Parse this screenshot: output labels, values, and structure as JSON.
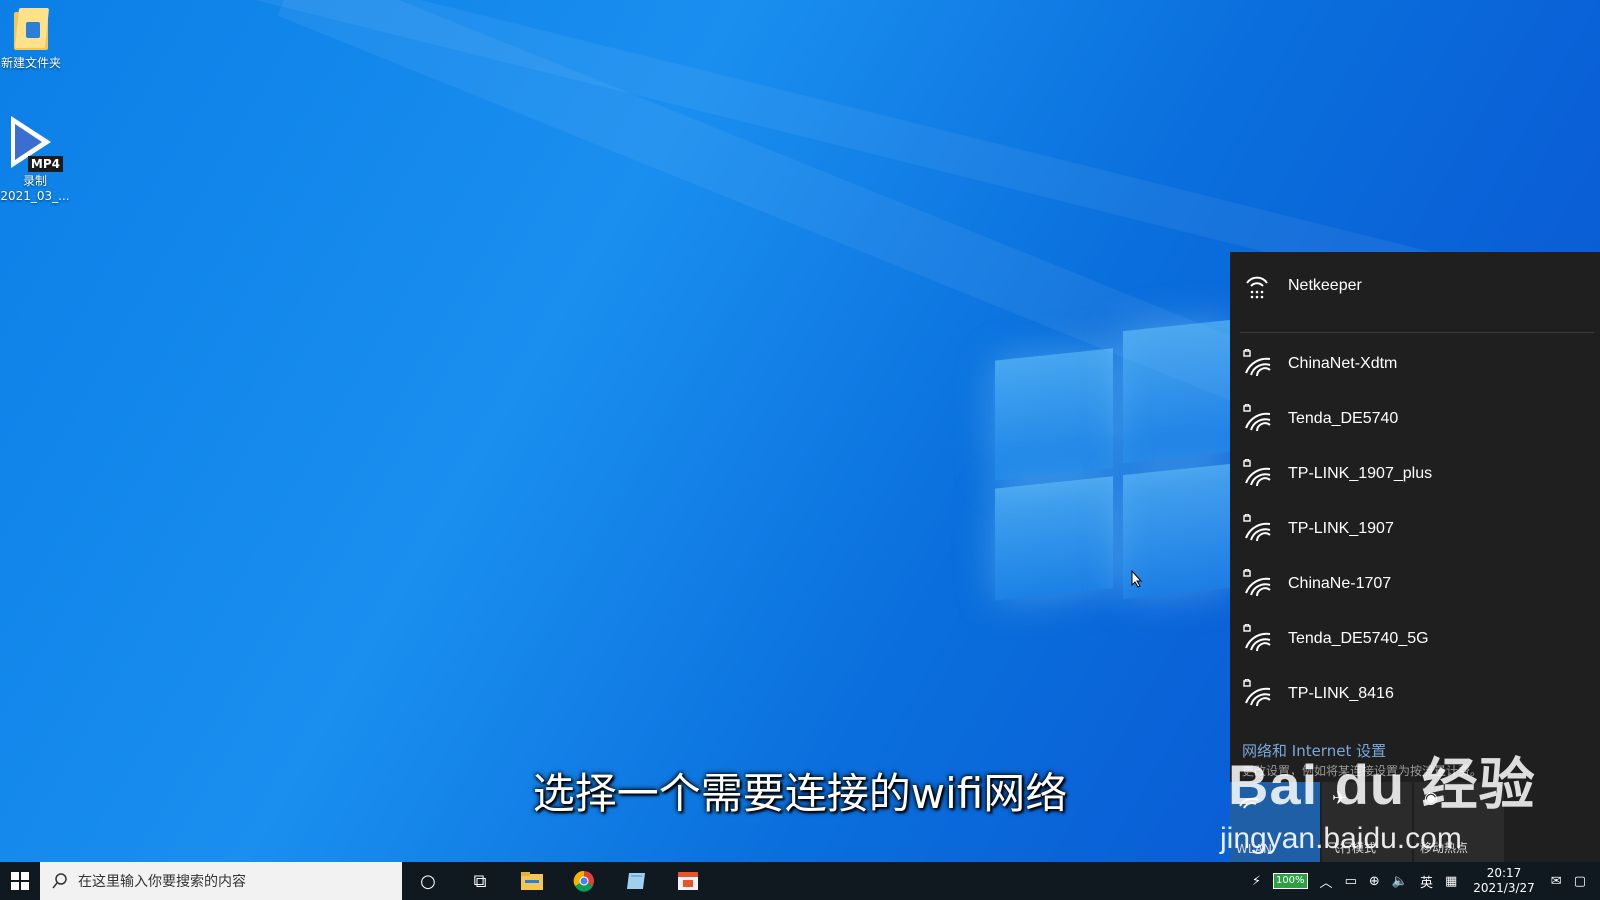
{
  "desktop": {
    "icons": [
      {
        "label": "新建文件夹"
      },
      {
        "label_line1": "录制",
        "label_line2": "2021_03_...",
        "badge": "MP4"
      }
    ]
  },
  "wifi_panel": {
    "connected": {
      "name": "Netkeeper",
      "icon": "dialup-icon"
    },
    "networks": [
      {
        "name": "ChinaNet-Xdtm",
        "secured": true
      },
      {
        "name": "Tenda_DE5740",
        "secured": true
      },
      {
        "name": "TP-LINK_1907_plus",
        "secured": true
      },
      {
        "name": "TP-LINK_1907",
        "secured": true
      },
      {
        "name": "ChinaNe-1707",
        "secured": true
      },
      {
        "name": "Tenda_DE5740_5G",
        "secured": true
      },
      {
        "name": "TP-LINK_8416",
        "secured": true
      }
    ],
    "settings_title": "网络和 Internet 设置",
    "settings_desc": "更改设置，例如将某连接设置为按流量计费。",
    "quick_actions": [
      {
        "label": "WLAN",
        "active": true
      },
      {
        "label": "飞行模式",
        "active": false
      },
      {
        "label": "移动热点",
        "active": false
      }
    ]
  },
  "watermark": {
    "brand": "Bai du 经验",
    "url": "jingyan.baidu.com"
  },
  "subtitle": "选择一个需要连接的wifi网络",
  "taskbar": {
    "search_placeholder": "在这里输入你要搜索的内容",
    "tray": {
      "battery": "100%",
      "ime_lang": "英",
      "time": "20:17",
      "date": "2021/3/27"
    }
  },
  "colors": {
    "accent": "#1f5fa8",
    "panel_bg": "#1f1f1f",
    "taskbar_bg": "#101820"
  }
}
